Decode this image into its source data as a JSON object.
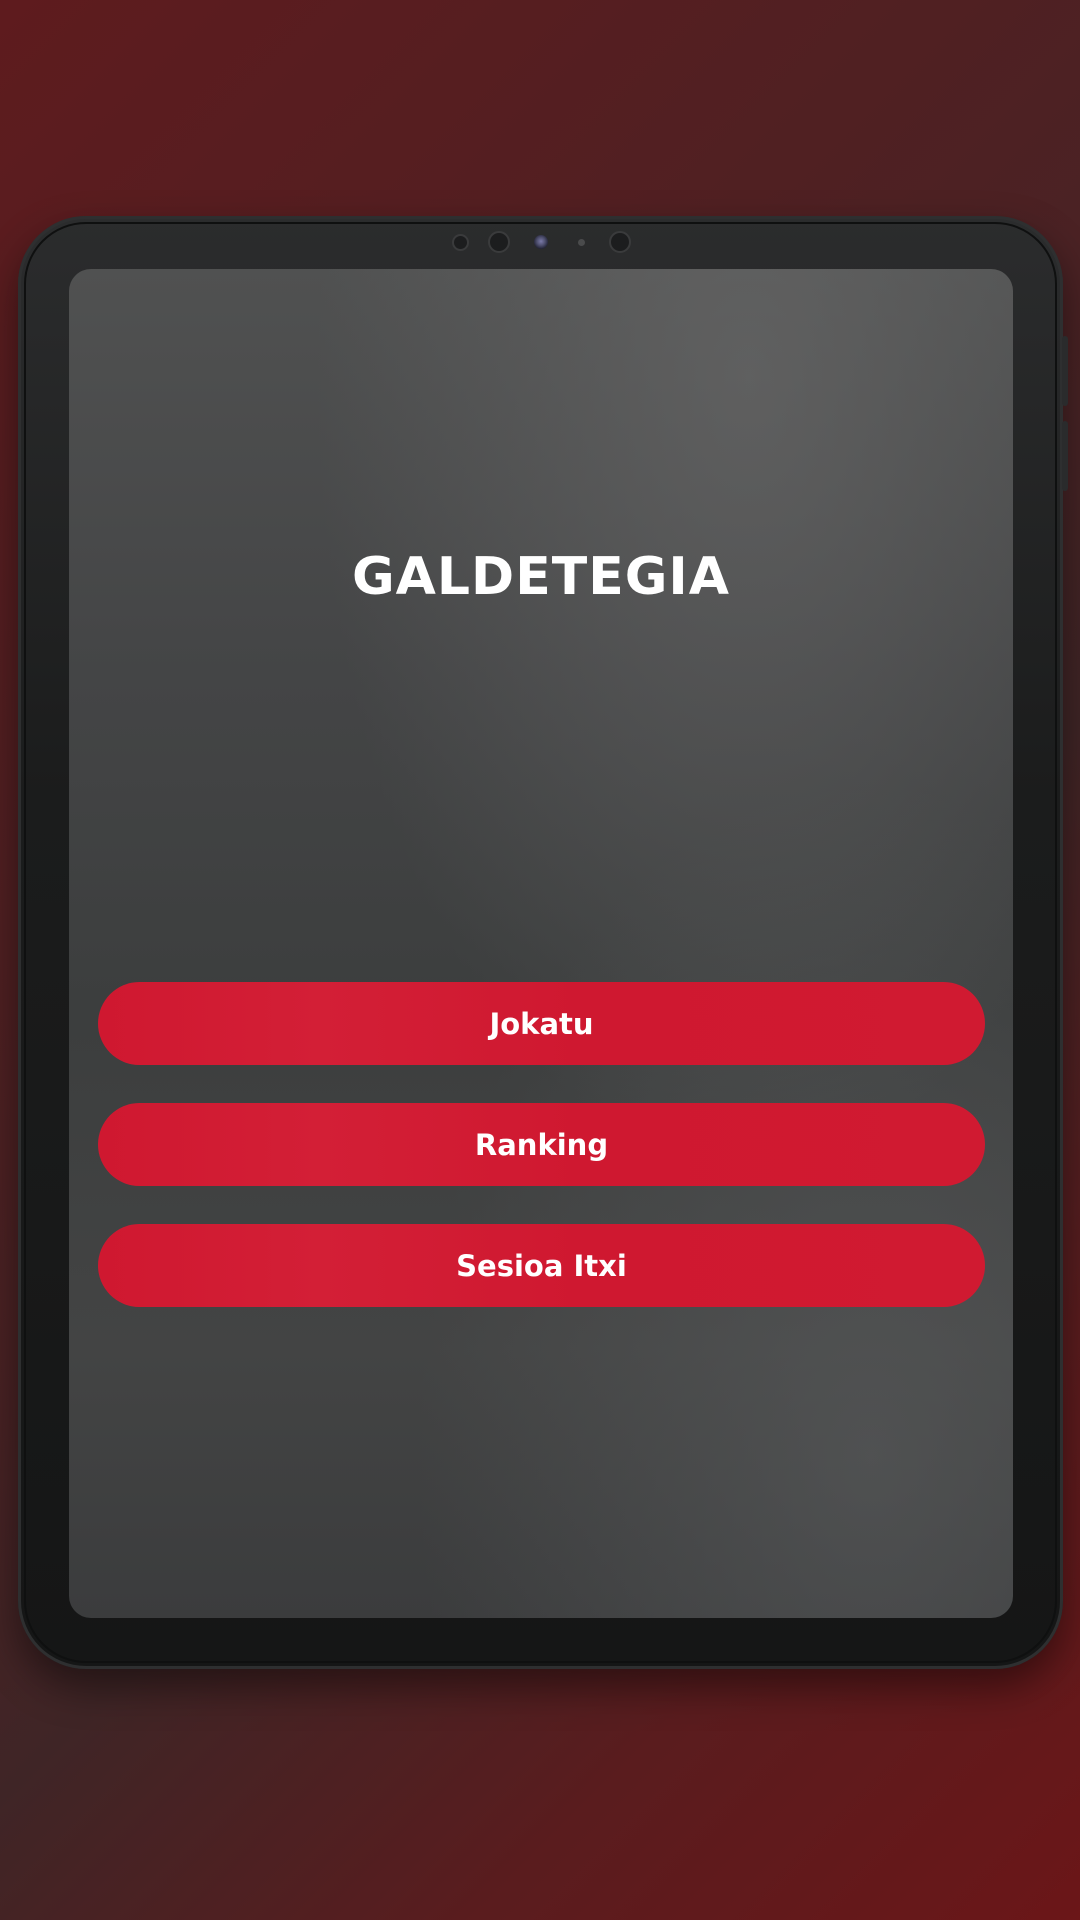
{
  "app": {
    "title": "GALDETEGIA"
  },
  "menu": {
    "buttons": [
      {
        "label": "Jokatu"
      },
      {
        "label": "Ranking"
      },
      {
        "label": "Sesioa Itxi"
      }
    ]
  },
  "colors": {
    "button_accent": "#cf1830",
    "background_dark_red": "#5e1b1e",
    "screen_gray": "#444546",
    "text": "#ffffff"
  }
}
